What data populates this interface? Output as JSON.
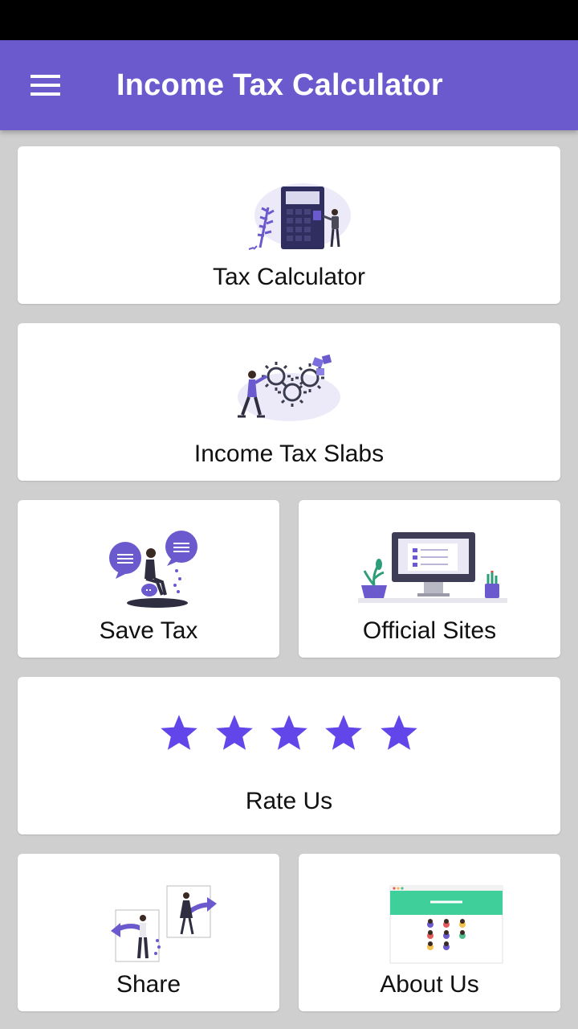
{
  "app_bar": {
    "title": "Income Tax Calculator",
    "menu_icon": "hamburger-menu-icon",
    "background": "#6a5acd"
  },
  "cards": {
    "tax_calculator": {
      "label": "Tax Calculator",
      "icon": "calculator-illustration"
    },
    "tax_slabs": {
      "label": "Income Tax Slabs",
      "icon": "gears-illustration"
    },
    "save_tax": {
      "label": "Save Tax",
      "icon": "chat-bubbles-illustration"
    },
    "official_sites": {
      "label": "Official Sites",
      "icon": "monitor-illustration"
    },
    "rate_us": {
      "label": "Rate Us",
      "icon": "star-icon",
      "rating": 5,
      "max_rating": 5
    },
    "share": {
      "label": "Share",
      "icon": "share-arrows-illustration"
    },
    "about_us": {
      "label": "About Us",
      "icon": "team-website-illustration"
    }
  },
  "colors": {
    "accent": "#6a5acd",
    "star": "#6246ea",
    "background": "#cfcfcf",
    "card": "#ffffff"
  }
}
